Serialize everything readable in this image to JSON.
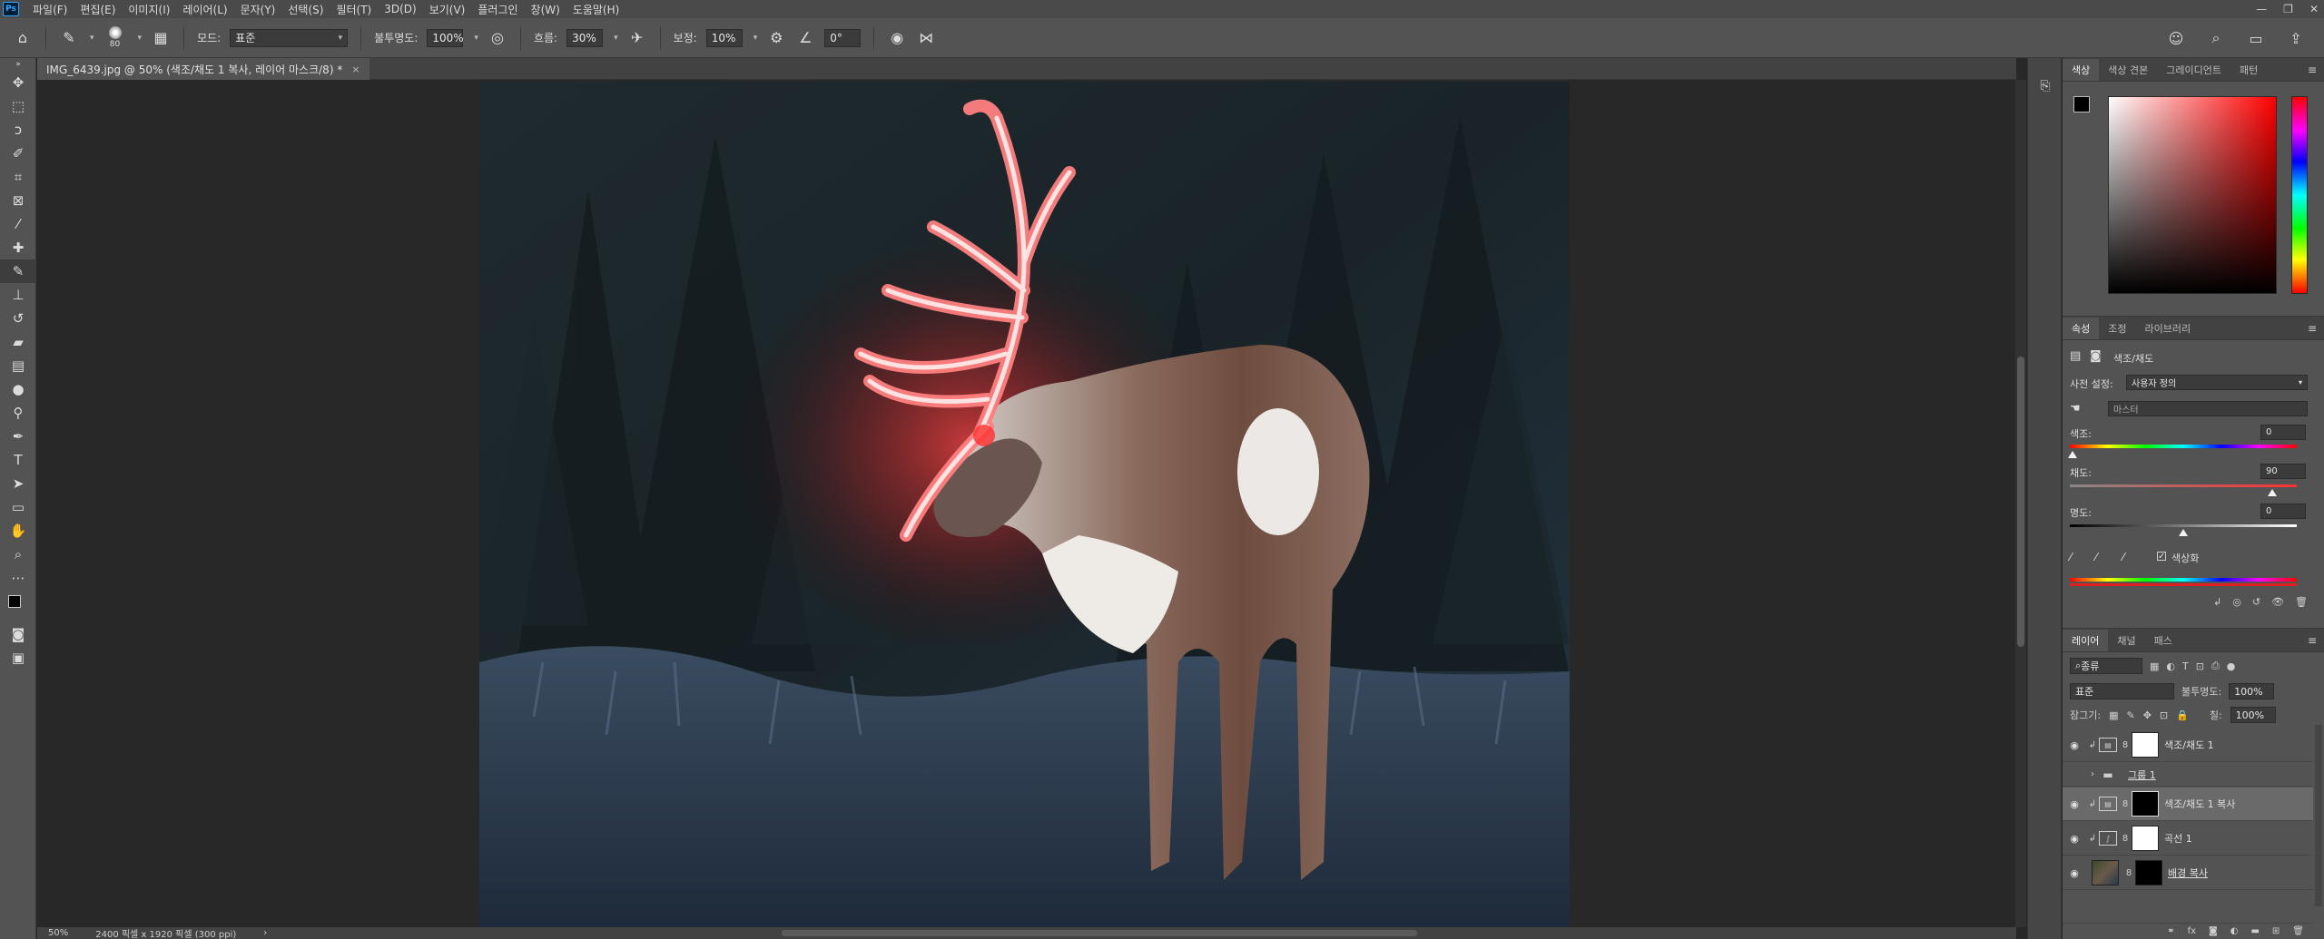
{
  "app": {
    "logo": "Ps"
  },
  "menu": [
    "파일(F)",
    "편집(E)",
    "이미지(I)",
    "레이어(L)",
    "문자(Y)",
    "선택(S)",
    "필터(T)",
    "3D(D)",
    "보기(V)",
    "플러그인",
    "창(W)",
    "도움말(H)"
  ],
  "window_controls": {
    "minimize": "—",
    "restore": "❐",
    "close": "✕"
  },
  "options": {
    "brush_size": "80",
    "mode_label": "모드:",
    "mode_value": "표준",
    "opacity_label": "불투명도:",
    "opacity_value": "100%",
    "flow_label": "흐름:",
    "flow_value": "30%",
    "smoothing_label": "보정:",
    "smoothing_value": "10%",
    "angle_value": "0°"
  },
  "document": {
    "tab_title": "IMG_6439.jpg @ 50% (색조/채도 1 복사, 레이어 마스크/8) *",
    "tab_close": "×"
  },
  "status": {
    "zoom": "50%",
    "doc_info": "2400 픽셀 x 1920 픽셀 (300 ppi)",
    "arrow": "›"
  },
  "color_panel": {
    "tabs": [
      "색상",
      "색상 견본",
      "그레이디언트",
      "패턴"
    ],
    "foreground": "#000000",
    "background": "#000000"
  },
  "properties_panel": {
    "tabs": [
      "속성",
      "조정",
      "라이브러리"
    ],
    "title": "색조/채도",
    "preset_label": "사전 설정:",
    "preset_value": "사용자 정의",
    "channel_value": "마스터",
    "hue_label": "색조:",
    "hue_value": "0",
    "saturation_label": "채도:",
    "saturation_value": "90",
    "lightness_label": "명도:",
    "lightness_value": "0",
    "colorize_label": "색상화",
    "colorize_checked": true
  },
  "layers_panel": {
    "tabs": [
      "레이어",
      "채널",
      "패스"
    ],
    "filter_label": "종류",
    "blend_mode": "표준",
    "opacity_label": "불투명도:",
    "opacity_value": "100%",
    "lock_label": "잠그기:",
    "fill_label": "칠:",
    "fill_value": "100%",
    "layers": [
      {
        "name": "색조/채도 1",
        "type": "adjustment",
        "mask": "white"
      },
      {
        "name": "그룹 1",
        "type": "group"
      },
      {
        "name": "색조/채도 1 복사",
        "type": "adjustment",
        "mask": "black",
        "selected": true
      },
      {
        "name": "곡선 1",
        "type": "curves",
        "mask": "white"
      },
      {
        "name": "배경 복사",
        "type": "image",
        "mask": "deer"
      }
    ],
    "bottom_icons": [
      "link-icon",
      "fx-icon",
      "mask-icon",
      "adjustment-icon",
      "folder-icon",
      "new-layer-icon",
      "trash-icon"
    ],
    "bottom_fx": "fx"
  }
}
